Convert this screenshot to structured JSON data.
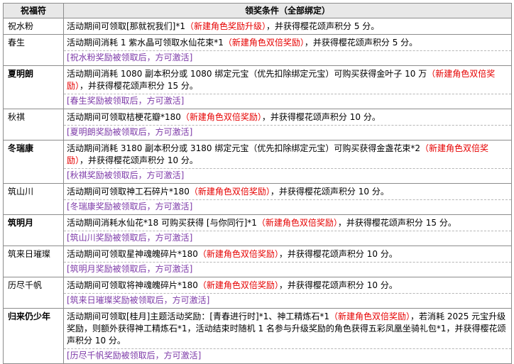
{
  "header": {
    "col1": "祝福符",
    "col2": "领奖条件（全部绑定）"
  },
  "rows": [
    {
      "name": "祝水粉",
      "bold": false,
      "text_a": "活动期间可领取[那就祝我们]*1",
      "red": "（新建角色奖励升级）",
      "text_b": "，并获得樱花颂声积分 5 分。",
      "note": ""
    },
    {
      "name": "春生",
      "bold": false,
      "text_a": "活动期间消耗 1 紫水晶可领取水仙花束*1",
      "red": "（新建角色双倍奖励）",
      "text_b": "，并获得樱花颂声积分 5 分。",
      "note": "[祝水粉奖励被领取后，方可激活]"
    },
    {
      "name": "夏明朗",
      "bold": true,
      "text_a": "活动期间消耗 1080 副本积分或 1080 绑定元宝（优先扣除绑定元宝）可购买获得金叶子 10 万",
      "red": "（新建角色双倍奖励）",
      "text_b": "，并获得樱花颂声积分 15 分。",
      "note": "[春生奖励被领取后，方可激活]"
    },
    {
      "name": "秋祺",
      "bold": false,
      "text_a": "活动期间可领取桔梗花瓣*180",
      "red": "（新建角色双倍奖励）",
      "text_b": "，并获得樱花颂声积分 10 分。",
      "note": "[夏明朗奖励被领取后，方可激活]"
    },
    {
      "name": "冬瑞康",
      "bold": true,
      "text_a": "活动期间消耗 3180 副本积分或 3180 绑定元宝（优先扣除绑定元宝）可购买获得金盏花束*2",
      "red": "（新建角色双倍奖励）",
      "text_b": "，并获得樱花颂声积分 10 分。",
      "note": "[秋祺奖励被领取后，方可激活]"
    },
    {
      "name": "筑山川",
      "bold": false,
      "text_a": "活动期间可领取神工石碎片*180",
      "red": "（新建角色双倍奖励）",
      "text_b": "，并获得樱花颂声积分 10 分。",
      "note": "[冬瑞康奖励被领取后，方可激活]"
    },
    {
      "name": "筑明月",
      "bold": true,
      "text_a": "活动期间消耗水仙花*18 可购买获得 [与你同行]*1",
      "red": "（新建角色双倍奖励）",
      "text_b": "，并获得樱花颂声积分 15 分。",
      "note": "[筑山川奖励被领取后，方可激活]"
    },
    {
      "name": "筑来日璀璨",
      "bold": false,
      "text_a": "活动期间可领取星神魂魄碎片*180",
      "red": "（新建角色双倍奖励）",
      "text_b": "，并获得樱花颂声积分 10 分。",
      "note": "[筑明月奖励被领取后，方可激活]"
    },
    {
      "name": "历尽千帆",
      "bold": false,
      "text_a": "活动期间可领取将神魂魄碎片*180",
      "red": "（新建角色双倍奖励）",
      "text_b": "，并获得樱花颂声积分 10 分。",
      "note": "[筑来日璀璨奖励被领取后，方可激活]"
    },
    {
      "name": "归来仍少年",
      "bold": true,
      "text_a": "活动期间可领取[桂月]主题活动奖励：[青春进行时]*1、神工精炼石*1",
      "red": "（新建角色双倍奖励）",
      "text_b": "，若消耗 2025 元宝升级奖励，则额外获得神工精炼石*1，活动结束时随机 1 名参与升级奖励的角色获得五彩凤凰坐骑礼包*1，并获得樱花颂声积分 10 分。",
      "note": "[历尽千帆奖励被领取后，方可激活]"
    }
  ]
}
